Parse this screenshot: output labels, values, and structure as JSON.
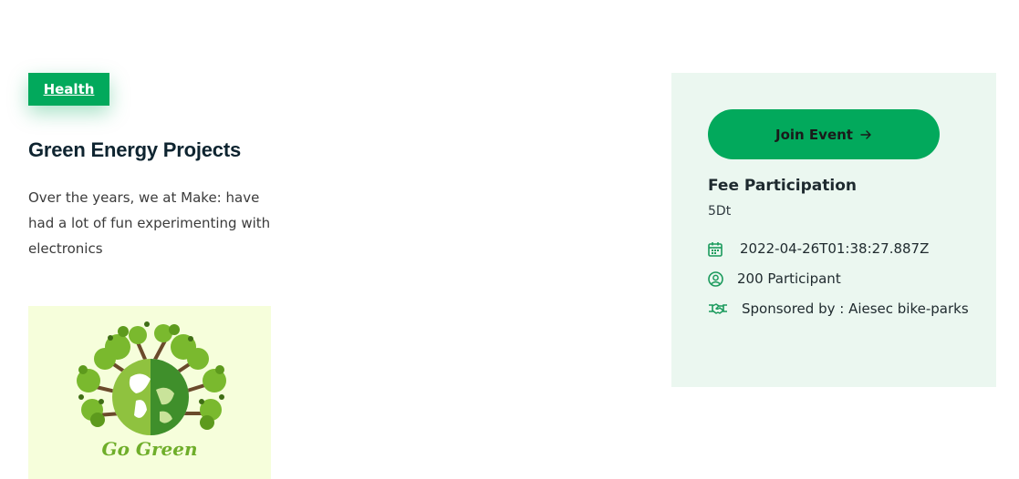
{
  "category": {
    "label": "Health"
  },
  "event": {
    "title": "Green Energy Projects",
    "description": "Over the years, we at Make: have had a lot of fun experimenting with electronics",
    "image_caption": "Go Green"
  },
  "panel": {
    "join_label": "Join Event",
    "fee_title": "Fee Participation",
    "fee_value": "5Dt",
    "date": "2022-04-26T01:38:27.887Z",
    "participants": "200 Participant",
    "sponsor": "Sponsored by : Aiesec bike-parks"
  },
  "icons": {
    "join": "arrow-right-icon",
    "date": "calendar-icon",
    "participants": "user-circle-icon",
    "sponsor": "handshake-icon"
  },
  "colors": {
    "accent": "#02a95c",
    "panel_bg": "#ebf7f0",
    "image_bg": "#f6fedb",
    "title": "#0e2430"
  }
}
